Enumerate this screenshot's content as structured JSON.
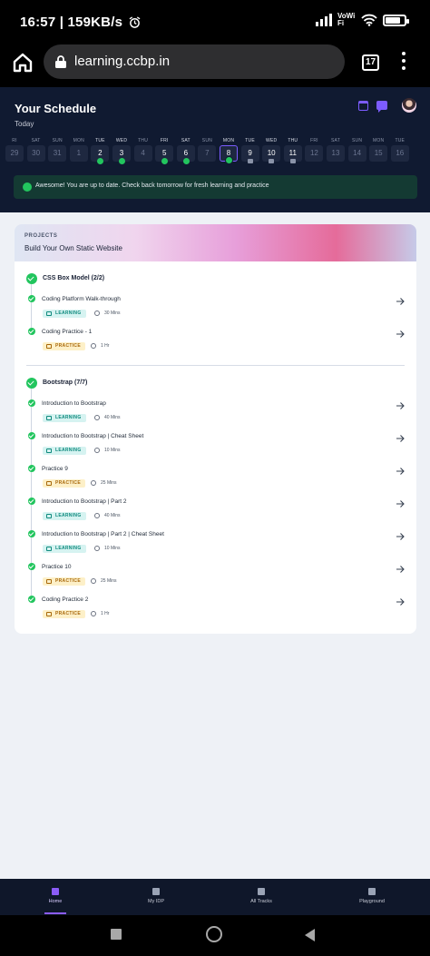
{
  "status_bar": {
    "time": "16:57",
    "speed": "159KB/s",
    "network": "VoWiFi",
    "battery_level": 0.8
  },
  "browser": {
    "url": "learning.ccbp.in",
    "tab_count": "17"
  },
  "schedule": {
    "title": "Your Schedule",
    "subtitle": "Today",
    "days": [
      {
        "name": "RI",
        "num": "29",
        "state": "past"
      },
      {
        "name": "SAT",
        "num": "30",
        "state": "past"
      },
      {
        "name": "SUN",
        "num": "31",
        "state": "past"
      },
      {
        "name": "MON",
        "num": "1",
        "state": "past"
      },
      {
        "name": "TUE",
        "num": "2",
        "state": "done"
      },
      {
        "name": "WED",
        "num": "3",
        "state": "done"
      },
      {
        "name": "THU",
        "num": "4",
        "state": "past"
      },
      {
        "name": "FRI",
        "num": "5",
        "state": "done"
      },
      {
        "name": "SAT",
        "num": "6",
        "state": "done"
      },
      {
        "name": "SUN",
        "num": "7",
        "state": "past"
      },
      {
        "name": "MON",
        "num": "8",
        "state": "today"
      },
      {
        "name": "TUE",
        "num": "9",
        "state": "locked"
      },
      {
        "name": "WED",
        "num": "10",
        "state": "locked"
      },
      {
        "name": "THU",
        "num": "11",
        "state": "locked"
      },
      {
        "name": "FRI",
        "num": "12",
        "state": "future"
      },
      {
        "name": "SAT",
        "num": "13",
        "state": "future"
      },
      {
        "name": "SUN",
        "num": "14",
        "state": "future"
      },
      {
        "name": "MON",
        "num": "15",
        "state": "future"
      },
      {
        "name": "TUE",
        "num": "16",
        "state": "future"
      }
    ],
    "banner": "Awesome! You are up to date. Check back tomorrow for fresh learning and practice"
  },
  "project": {
    "label": "PROJECTS",
    "title": "Build Your Own Static Website",
    "sections": [
      {
        "title": "CSS Box Model (2/2)",
        "items": [
          {
            "title": "Coding Platform Walk-through",
            "tag": "LEARNING",
            "duration": "30 Mins"
          },
          {
            "title": "Coding Practice - 1",
            "tag": "PRACTICE",
            "duration": "1 Hr"
          }
        ]
      },
      {
        "title": "Bootstrap (7/7)",
        "items": [
          {
            "title": "Introduction to Bootstrap",
            "tag": "LEARNING",
            "duration": "40 Mins"
          },
          {
            "title": "Introduction to Bootstrap | Cheat Sheet",
            "tag": "LEARNING",
            "duration": "10 Mins"
          },
          {
            "title": "Practice 9",
            "tag": "PRACTICE",
            "duration": "25 Mins"
          },
          {
            "title": "Introduction to Bootstrap | Part 2",
            "tag": "LEARNING",
            "duration": "40 Mins"
          },
          {
            "title": "Introduction to Bootstrap | Part 2 | Cheat Sheet",
            "tag": "LEARNING",
            "duration": "10 Mins"
          },
          {
            "title": "Practice 10",
            "tag": "PRACTICE",
            "duration": "25 Mins"
          },
          {
            "title": "Coding Practice 2",
            "tag": "PRACTICE",
            "duration": "1 Hr"
          }
        ]
      }
    ]
  },
  "bottom_nav": [
    {
      "label": "Home",
      "icon": "home-icon",
      "active": true
    },
    {
      "label": "My IDP",
      "icon": "document-icon",
      "active": false
    },
    {
      "label": "All Tracks",
      "icon": "book-icon",
      "active": false
    },
    {
      "label": "Playground",
      "icon": "terminal-icon",
      "active": false
    }
  ],
  "colors": {
    "accent": "#7c5cff",
    "success": "#22c55e",
    "header_bg": "#101a31"
  }
}
